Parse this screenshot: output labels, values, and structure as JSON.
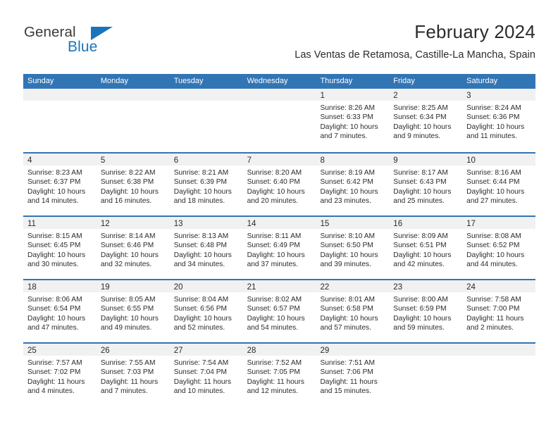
{
  "brand": {
    "name_part1": "General",
    "name_part2": "Blue",
    "triangle_icon": "triangle-logo-icon",
    "accent_color": "#1a74bb"
  },
  "header": {
    "title": "February 2024",
    "subtitle": "Las Ventas de Retamosa, Castille-La Mancha, Spain"
  },
  "theme": {
    "header_blue": "#3275b5",
    "daynum_band": "#f1f1f1",
    "text": "#2b2b2b"
  },
  "calendar": {
    "weekday_headers": [
      "Sunday",
      "Monday",
      "Tuesday",
      "Wednesday",
      "Thursday",
      "Friday",
      "Saturday"
    ],
    "weeks": [
      [
        {
          "day": "",
          "lines": []
        },
        {
          "day": "",
          "lines": []
        },
        {
          "day": "",
          "lines": []
        },
        {
          "day": "",
          "lines": []
        },
        {
          "day": "1",
          "lines": [
            "Sunrise: 8:26 AM",
            "Sunset: 6:33 PM",
            "Daylight: 10 hours",
            "and 7 minutes."
          ]
        },
        {
          "day": "2",
          "lines": [
            "Sunrise: 8:25 AM",
            "Sunset: 6:34 PM",
            "Daylight: 10 hours",
            "and 9 minutes."
          ]
        },
        {
          "day": "3",
          "lines": [
            "Sunrise: 8:24 AM",
            "Sunset: 6:36 PM",
            "Daylight: 10 hours",
            "and 11 minutes."
          ]
        }
      ],
      [
        {
          "day": "4",
          "lines": [
            "Sunrise: 8:23 AM",
            "Sunset: 6:37 PM",
            "Daylight: 10 hours",
            "and 14 minutes."
          ]
        },
        {
          "day": "5",
          "lines": [
            "Sunrise: 8:22 AM",
            "Sunset: 6:38 PM",
            "Daylight: 10 hours",
            "and 16 minutes."
          ]
        },
        {
          "day": "6",
          "lines": [
            "Sunrise: 8:21 AM",
            "Sunset: 6:39 PM",
            "Daylight: 10 hours",
            "and 18 minutes."
          ]
        },
        {
          "day": "7",
          "lines": [
            "Sunrise: 8:20 AM",
            "Sunset: 6:40 PM",
            "Daylight: 10 hours",
            "and 20 minutes."
          ]
        },
        {
          "day": "8",
          "lines": [
            "Sunrise: 8:19 AM",
            "Sunset: 6:42 PM",
            "Daylight: 10 hours",
            "and 23 minutes."
          ]
        },
        {
          "day": "9",
          "lines": [
            "Sunrise: 8:17 AM",
            "Sunset: 6:43 PM",
            "Daylight: 10 hours",
            "and 25 minutes."
          ]
        },
        {
          "day": "10",
          "lines": [
            "Sunrise: 8:16 AM",
            "Sunset: 6:44 PM",
            "Daylight: 10 hours",
            "and 27 minutes."
          ]
        }
      ],
      [
        {
          "day": "11",
          "lines": [
            "Sunrise: 8:15 AM",
            "Sunset: 6:45 PM",
            "Daylight: 10 hours",
            "and 30 minutes."
          ]
        },
        {
          "day": "12",
          "lines": [
            "Sunrise: 8:14 AM",
            "Sunset: 6:46 PM",
            "Daylight: 10 hours",
            "and 32 minutes."
          ]
        },
        {
          "day": "13",
          "lines": [
            "Sunrise: 8:13 AM",
            "Sunset: 6:48 PM",
            "Daylight: 10 hours",
            "and 34 minutes."
          ]
        },
        {
          "day": "14",
          "lines": [
            "Sunrise: 8:11 AM",
            "Sunset: 6:49 PM",
            "Daylight: 10 hours",
            "and 37 minutes."
          ]
        },
        {
          "day": "15",
          "lines": [
            "Sunrise: 8:10 AM",
            "Sunset: 6:50 PM",
            "Daylight: 10 hours",
            "and 39 minutes."
          ]
        },
        {
          "day": "16",
          "lines": [
            "Sunrise: 8:09 AM",
            "Sunset: 6:51 PM",
            "Daylight: 10 hours",
            "and 42 minutes."
          ]
        },
        {
          "day": "17",
          "lines": [
            "Sunrise: 8:08 AM",
            "Sunset: 6:52 PM",
            "Daylight: 10 hours",
            "and 44 minutes."
          ]
        }
      ],
      [
        {
          "day": "18",
          "lines": [
            "Sunrise: 8:06 AM",
            "Sunset: 6:54 PM",
            "Daylight: 10 hours",
            "and 47 minutes."
          ]
        },
        {
          "day": "19",
          "lines": [
            "Sunrise: 8:05 AM",
            "Sunset: 6:55 PM",
            "Daylight: 10 hours",
            "and 49 minutes."
          ]
        },
        {
          "day": "20",
          "lines": [
            "Sunrise: 8:04 AM",
            "Sunset: 6:56 PM",
            "Daylight: 10 hours",
            "and 52 minutes."
          ]
        },
        {
          "day": "21",
          "lines": [
            "Sunrise: 8:02 AM",
            "Sunset: 6:57 PM",
            "Daylight: 10 hours",
            "and 54 minutes."
          ]
        },
        {
          "day": "22",
          "lines": [
            "Sunrise: 8:01 AM",
            "Sunset: 6:58 PM",
            "Daylight: 10 hours",
            "and 57 minutes."
          ]
        },
        {
          "day": "23",
          "lines": [
            "Sunrise: 8:00 AM",
            "Sunset: 6:59 PM",
            "Daylight: 10 hours",
            "and 59 minutes."
          ]
        },
        {
          "day": "24",
          "lines": [
            "Sunrise: 7:58 AM",
            "Sunset: 7:00 PM",
            "Daylight: 11 hours",
            "and 2 minutes."
          ]
        }
      ],
      [
        {
          "day": "25",
          "lines": [
            "Sunrise: 7:57 AM",
            "Sunset: 7:02 PM",
            "Daylight: 11 hours",
            "and 4 minutes."
          ]
        },
        {
          "day": "26",
          "lines": [
            "Sunrise: 7:55 AM",
            "Sunset: 7:03 PM",
            "Daylight: 11 hours",
            "and 7 minutes."
          ]
        },
        {
          "day": "27",
          "lines": [
            "Sunrise: 7:54 AM",
            "Sunset: 7:04 PM",
            "Daylight: 11 hours",
            "and 10 minutes."
          ]
        },
        {
          "day": "28",
          "lines": [
            "Sunrise: 7:52 AM",
            "Sunset: 7:05 PM",
            "Daylight: 11 hours",
            "and 12 minutes."
          ]
        },
        {
          "day": "29",
          "lines": [
            "Sunrise: 7:51 AM",
            "Sunset: 7:06 PM",
            "Daylight: 11 hours",
            "and 15 minutes."
          ]
        },
        {
          "day": "",
          "lines": []
        },
        {
          "day": "",
          "lines": []
        }
      ]
    ]
  }
}
